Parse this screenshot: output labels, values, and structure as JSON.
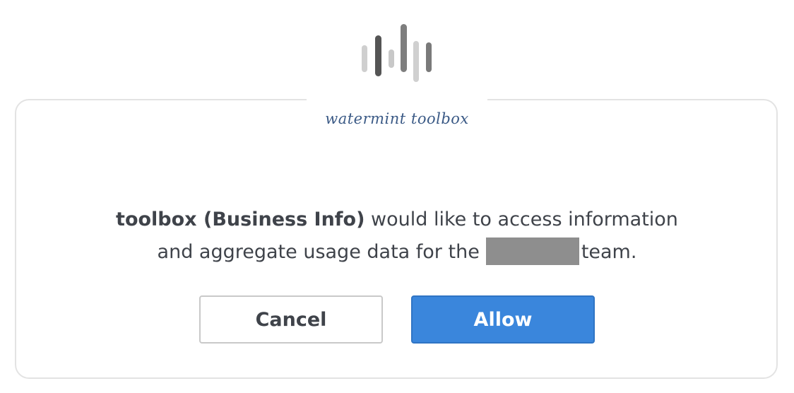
{
  "brand": {
    "logo_icon": "sound-bars-logo-icon",
    "wordmark": "watermint toolbox"
  },
  "dialog": {
    "app_name": "toolbox (Business Info)",
    "message_part1": " would like to access information",
    "message_part2": "and aggregate usage data for the",
    "message_part3": "team.",
    "team_name_redacted": true
  },
  "buttons": {
    "cancel_label": "Cancel",
    "allow_label": "Allow"
  },
  "colors": {
    "allow_button": "#3a86dc",
    "wordmark": "#3b5a86",
    "text": "#3f434a",
    "redaction": "#8e8e8e"
  }
}
